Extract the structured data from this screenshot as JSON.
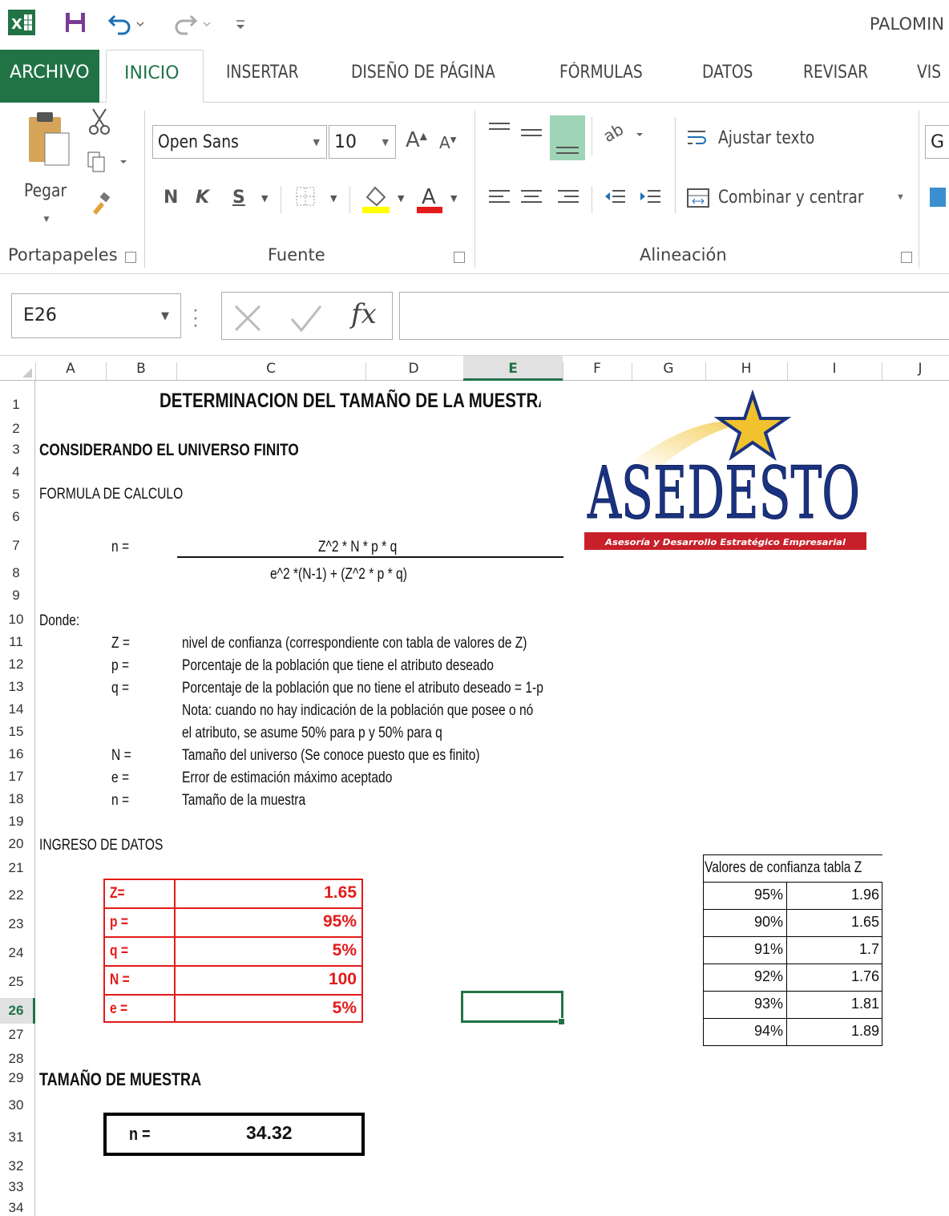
{
  "qat": {
    "title": "PALOMIN"
  },
  "tabs": [
    "ARCHIVO",
    "INICIO",
    "INSERTAR",
    "DISEÑO DE PÁGINA",
    "FÓRMULAS",
    "DATOS",
    "REVISAR",
    "VIS"
  ],
  "ribbon": {
    "paste_label": "Pegar",
    "font_name": "Open Sans",
    "font_size": "10",
    "bold": "N",
    "italic": "K",
    "underline": "S",
    "wrap_text": "Ajustar texto",
    "merge_center": "Combinar y centrar",
    "number_format_partial": "G",
    "groups": {
      "clipboard": "Portapapeles",
      "font": "Fuente",
      "alignment": "Alineación"
    }
  },
  "formula_bar": {
    "name_box": "E26",
    "fx": "fx",
    "content": ""
  },
  "columns": [
    "A",
    "B",
    "C",
    "D",
    "E",
    "F",
    "G",
    "H",
    "I",
    "J"
  ],
  "rows": [
    "1",
    "2",
    "3",
    "4",
    "5",
    "6",
    "7",
    "8",
    "9",
    "10",
    "11",
    "12",
    "13",
    "14",
    "15",
    "16",
    "17",
    "18",
    "19",
    "20",
    "21",
    "22",
    "23",
    "24",
    "25",
    "26",
    "27",
    "28",
    "29",
    "30",
    "31",
    "32",
    "33",
    "34"
  ],
  "sheet": {
    "title": "DETERMINACION DEL TAMAÑO DE LA MUESTRA",
    "universe": "CONSIDERANDO EL UNIVERSO FINITO",
    "formula_label": "FORMULA DE CALCULO",
    "n_eq": "n =",
    "numerator": "Z^2 * N * p * q",
    "denominator": "e^2 *(N-1) + (Z^2 * p * q)",
    "donde": "Donde:",
    "definitions": [
      {
        "sym": "Z =",
        "desc": "nivel de confianza (correspondiente con tabla de valores de Z)"
      },
      {
        "sym": "p =",
        "desc": "Porcentaje de la población que tiene el atributo deseado"
      },
      {
        "sym": "q =",
        "desc": "Porcentaje de la población que no tiene el atributo deseado = 1-p"
      },
      {
        "sym": "",
        "desc": "Nota: cuando no hay indicación de la población que posee o nó"
      },
      {
        "sym": "",
        "desc": "el atributo, se asume 50% para p y 50% para q"
      },
      {
        "sym": "N =",
        "desc": "Tamaño del universo (Se conoce puesto que es finito)"
      },
      {
        "sym": "e =",
        "desc": "Error de estimación máximo aceptado"
      },
      {
        "sym": "n =",
        "desc": "Tamaño de la muestra"
      }
    ],
    "ingreso": "INGRESO DE DATOS",
    "inputs": [
      {
        "label": "Z=",
        "value": "1.65"
      },
      {
        "label": "p =",
        "value": "95%"
      },
      {
        "label": "q =",
        "value": "5%"
      },
      {
        "label": "N =",
        "value": "100"
      },
      {
        "label": "e =",
        "value": "5%"
      }
    ],
    "ztable_title": "Valores de confianza tabla Z",
    "ztable": [
      {
        "conf": "95%",
        "z": "1.96"
      },
      {
        "conf": "90%",
        "z": "1.65"
      },
      {
        "conf": "91%",
        "z": "1.7"
      },
      {
        "conf": "92%",
        "z": "1.76"
      },
      {
        "conf": "93%",
        "z": "1.81"
      },
      {
        "conf": "94%",
        "z": "1.89"
      }
    ],
    "result_title": "TAMAÑO DE MUESTRA",
    "result_label": "n =",
    "result_value": "34.32"
  },
  "logo": {
    "text": "ASEDESTO",
    "tagline": "Asesoría y Desarrollo Estratégico Empresarial"
  },
  "colors": {
    "excel_green": "#217346",
    "input_red": "#e31b1b",
    "logo_blue": "#1a3380",
    "logo_red": "#c8202a",
    "logo_gold": "#f2c12e"
  }
}
